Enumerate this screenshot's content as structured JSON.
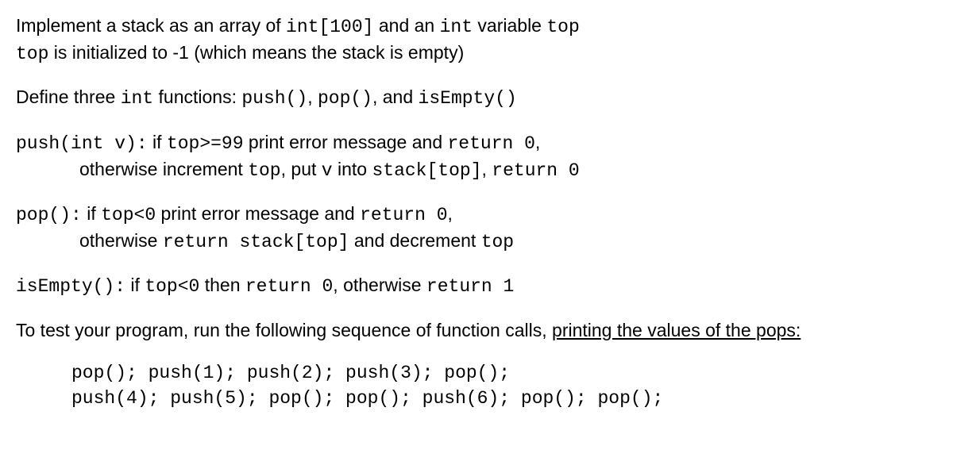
{
  "p1_l1": {
    "t1": "Implement a stack as an array of ",
    "c1": "int[100]",
    "t2": " and an ",
    "c2": "int",
    "t3": " variable ",
    "c3": "top"
  },
  "p1_l2": {
    "c1": "top",
    "t1": " is initialized to -1 (which means the stack is empty)"
  },
  "p2": {
    "t1": "Define three ",
    "c1": "int",
    "t2": " functions:  ",
    "c2": "push()",
    "t3": ", ",
    "c3": "pop()",
    "t4": ", and ",
    "c4": "isEmpty()"
  },
  "p3_l1": {
    "c1": "push(int v):",
    "t1": " if ",
    "c2": "top>=99",
    "t2": " print error message and ",
    "c3": "return 0",
    "t3": ","
  },
  "p3_l2": {
    "t1": "otherwise increment ",
    "c1": "top",
    "t2": ", put ",
    "c2": "v",
    "t3": " into ",
    "c3": "stack[top]",
    "t4": ", ",
    "c4": "return 0"
  },
  "p4_l1": {
    "c1": "pop():",
    "t1": " if ",
    "c2": "top<0",
    "t2": " print error message and ",
    "c3": "return 0",
    "t3": ","
  },
  "p4_l2": {
    "t1": "otherwise ",
    "c1": "return stack[top]",
    "t2": " and decrement ",
    "c2": "top"
  },
  "p5": {
    "c1": "isEmpty():",
    "t1": " if ",
    "c2": "top<0",
    "t2": " then ",
    "c3": "return 0",
    "t3": ", otherwise ",
    "c4": "return 1"
  },
  "p6": {
    "t1": "To test your program, run the following sequence of function calls, ",
    "u1": "printing the values of the pops:"
  },
  "code": {
    "l1": "pop(); push(1); push(2); push(3); pop();",
    "l2": "push(4); push(5); pop(); pop(); push(6); pop(); pop();"
  }
}
